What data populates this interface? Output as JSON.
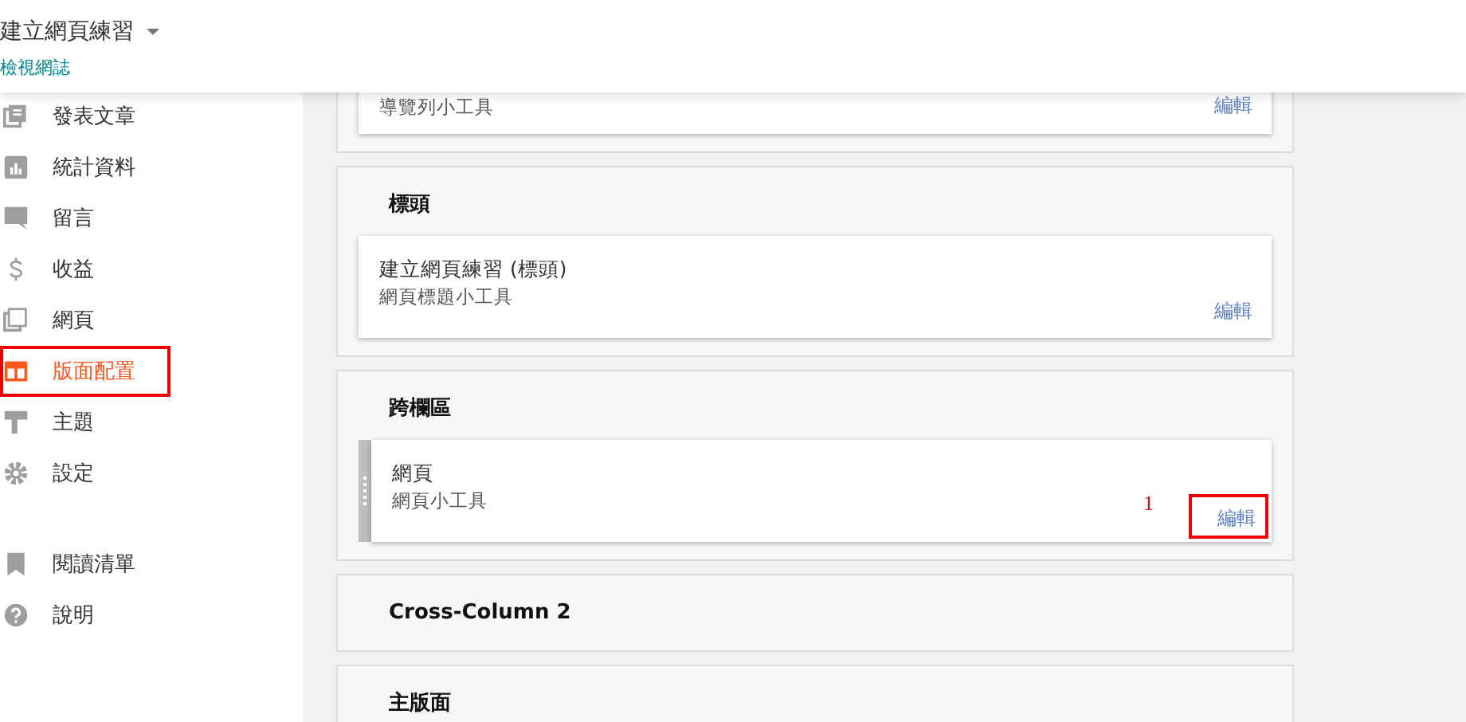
{
  "header": {
    "blog_title": "建立網頁練習",
    "view_blog_link": "檢視網誌"
  },
  "sidebar": {
    "items": [
      {
        "label": "發表文章",
        "selected": false,
        "highlighted": false
      },
      {
        "label": "統計資料",
        "selected": false,
        "highlighted": false
      },
      {
        "label": "留言",
        "selected": false,
        "highlighted": false
      },
      {
        "label": "收益",
        "selected": false,
        "highlighted": false
      },
      {
        "label": "網頁",
        "selected": false,
        "highlighted": false
      },
      {
        "label": "版面配置",
        "selected": true,
        "highlighted": true
      },
      {
        "label": "主題",
        "selected": false,
        "highlighted": false
      },
      {
        "label": "設定",
        "selected": false,
        "highlighted": false
      }
    ],
    "secondary_items": [
      {
        "label": "閱讀清單",
        "selected": false,
        "highlighted": false
      },
      {
        "label": "說明",
        "selected": false,
        "highlighted": false
      }
    ]
  },
  "sections": [
    {
      "widgets": [
        {
          "subtitle": "導覽列小工具",
          "edit": "編輯",
          "drag_handle": false,
          "highlighted": false
        }
      ]
    },
    {
      "title": "標頭",
      "widgets": [
        {
          "title": "建立網頁練習 (標頭)",
          "subtitle": "網頁標題小工具",
          "edit": "編輯",
          "drag_handle": false,
          "highlighted": false
        }
      ]
    },
    {
      "title": "跨欄區",
      "widgets": [
        {
          "title": "網頁",
          "subtitle": "網頁小工具",
          "edit": "編輯",
          "drag_handle": true,
          "highlighted": true,
          "annotation": "1"
        }
      ]
    },
    {
      "title": "Cross-Column 2"
    },
    {
      "title": "主版面"
    }
  ]
}
